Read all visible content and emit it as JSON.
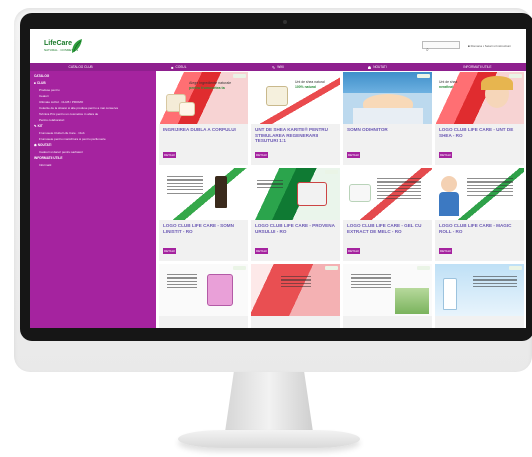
{
  "site": {
    "logo": {
      "name": "LifeCare",
      "tagline": "NATURAL · COSMETICS"
    },
    "search_placeholder": "",
    "header_links": "■ Romana   ▪ Setari si Instructiuni"
  },
  "nav": [
    {
      "label": "Catalog club",
      "icon": ""
    },
    {
      "label": "Cosul",
      "icon": "■"
    },
    {
      "label": "Wiki",
      "icon": "✎"
    },
    {
      "label": "Noutati",
      "icon": "☗"
    },
    {
      "label": "Informatii utile",
      "icon": ""
    }
  ],
  "sidebar": {
    "heading": "Catalog",
    "categories": [
      {
        "label": "Club",
        "items": [
          "Produse pentru",
          "Ceaiuri",
          "Ultimate Lichid · CLUB / PROMO",
          "Colectie de la sfoarei si alte produse pentru a mai conserva",
          "Tehnica Prix pentru un cosmetice in afara de",
          "Pentru colaboratori"
        ]
      },
      {
        "label": "Kit",
        "items": [
          "Frumusete Clubul Life Care · Club",
          "Frumusete pentru manichiura si pentru parfumerie"
        ]
      },
      {
        "label": "Noutati",
        "items": [
          "Cadouri si daruri pentru sarbatori"
        ]
      },
      {
        "label": "Informatii utile",
        "items": [
          "Informatii"
        ]
      }
    ]
  },
  "products": [
    {
      "title": "INGRIJIREA DUBLA A CORPULUI",
      "button": "DETALII",
      "img_text": [
        "Alege Ingrediente naturale",
        "pentru frumusetea ta"
      ]
    },
    {
      "title": "UNT DE SHEA KARITE® PENTRU STIMULAREA REGENERARII TESUTURI 1:1",
      "button": "DETALII",
      "img_text": [
        "Unt de shea natural",
        "100% natural"
      ]
    },
    {
      "title": "SOMN ODIHNITOR",
      "button": "DETALII",
      "img_text": []
    },
    {
      "title": "LOGO CLUB LIFE CARE - UNT DE SHEA - RO",
      "button": "DETALII",
      "img_text": [
        "Unt de shea",
        "nerafinat"
      ]
    },
    {
      "title": "LOGO CLUB LIFE CARE - SOMN LINISTIT - RO",
      "button": "DETALII",
      "img_text": []
    },
    {
      "title": "LOGO CLUB LIFE CARE - PROVENA URSULUI - RO",
      "button": "DETALII",
      "img_text": []
    },
    {
      "title": "LOGO CLUB LIFE CARE - GEL CU EXTRACT DE MELC - RO",
      "button": "DETALII",
      "img_text": []
    },
    {
      "title": "LOGO CLUB LIFE CARE - MAGIC ROLL - RO",
      "button": "DETALII",
      "img_text": []
    },
    {
      "title": "",
      "button": "",
      "img_text": []
    },
    {
      "title": "",
      "button": "",
      "img_text": []
    },
    {
      "title": "",
      "button": "",
      "img_text": []
    },
    {
      "title": "",
      "button": "",
      "img_text": []
    }
  ],
  "colors": {
    "brand_purple": "#a5239f",
    "nav_purple": "#8e1f8e",
    "title_violet": "#6b59b4",
    "logo_green": "#1a7a2a"
  }
}
